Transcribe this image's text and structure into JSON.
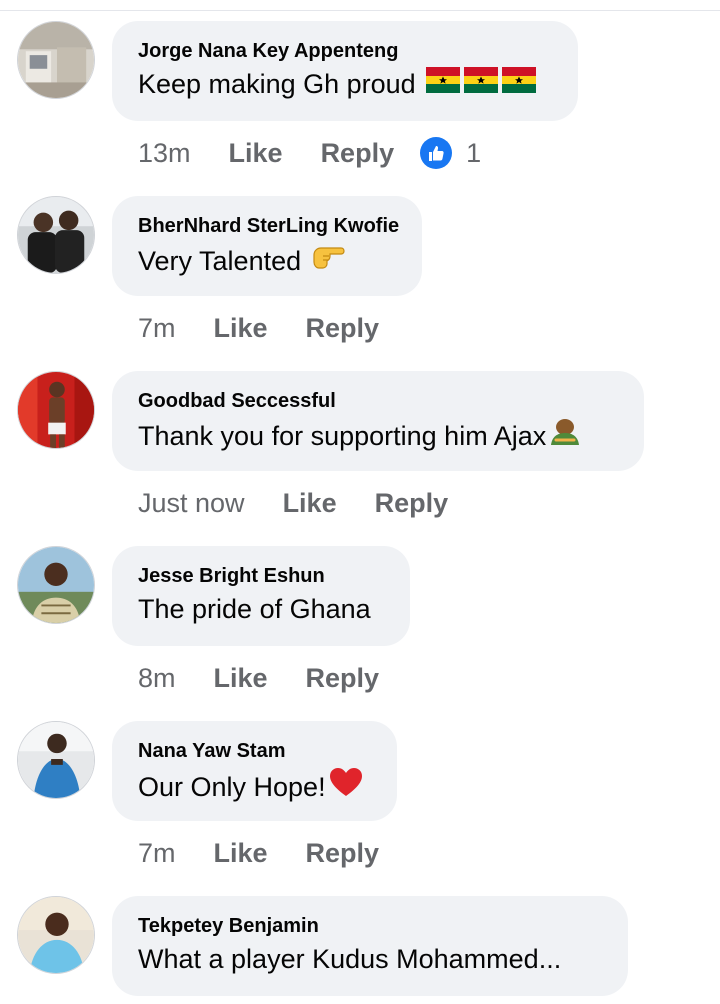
{
  "comments": [
    {
      "author": "Jorge Nana Key Appenteng",
      "text": "Keep making Gh proud",
      "emoji": [
        "ghana-flag",
        "ghana-flag",
        "ghana-flag"
      ],
      "time": "13m",
      "like_label": "Like",
      "reply_label": "Reply",
      "reaction": {
        "icon": "thumbs-up-icon",
        "count": "1"
      }
    },
    {
      "author": "BherNhard SterLing Kwofie",
      "text": "Very Talented",
      "emoji": [
        "backhand-index-pointing-right"
      ],
      "time": "7m",
      "like_label": "Like",
      "reply_label": "Reply"
    },
    {
      "author": "Goodbad Seccessful",
      "text": "Thank you for supporting him Ajax",
      "emoji": [
        "person-bowing"
      ],
      "time": "Just now",
      "like_label": "Like",
      "reply_label": "Reply"
    },
    {
      "author": "Jesse Bright Eshun",
      "text": "The pride of Ghana",
      "emoji": [],
      "time": "8m",
      "like_label": "Like",
      "reply_label": "Reply"
    },
    {
      "author": "Nana Yaw Stam",
      "text": "Our Only Hope!",
      "emoji": [
        "red-heart"
      ],
      "time": "7m",
      "like_label": "Like",
      "reply_label": "Reply"
    },
    {
      "author": "Tekpetey Benjamin",
      "text": "What a player Kudus Mohammed...",
      "emoji": []
    }
  ],
  "colors": {
    "bubble": "#f0f2f5",
    "meta_text": "#65676b",
    "like_blue": "#1877f2",
    "ghana_red": "#ce1126",
    "ghana_gold": "#fcd116",
    "ghana_green": "#006b3f"
  }
}
